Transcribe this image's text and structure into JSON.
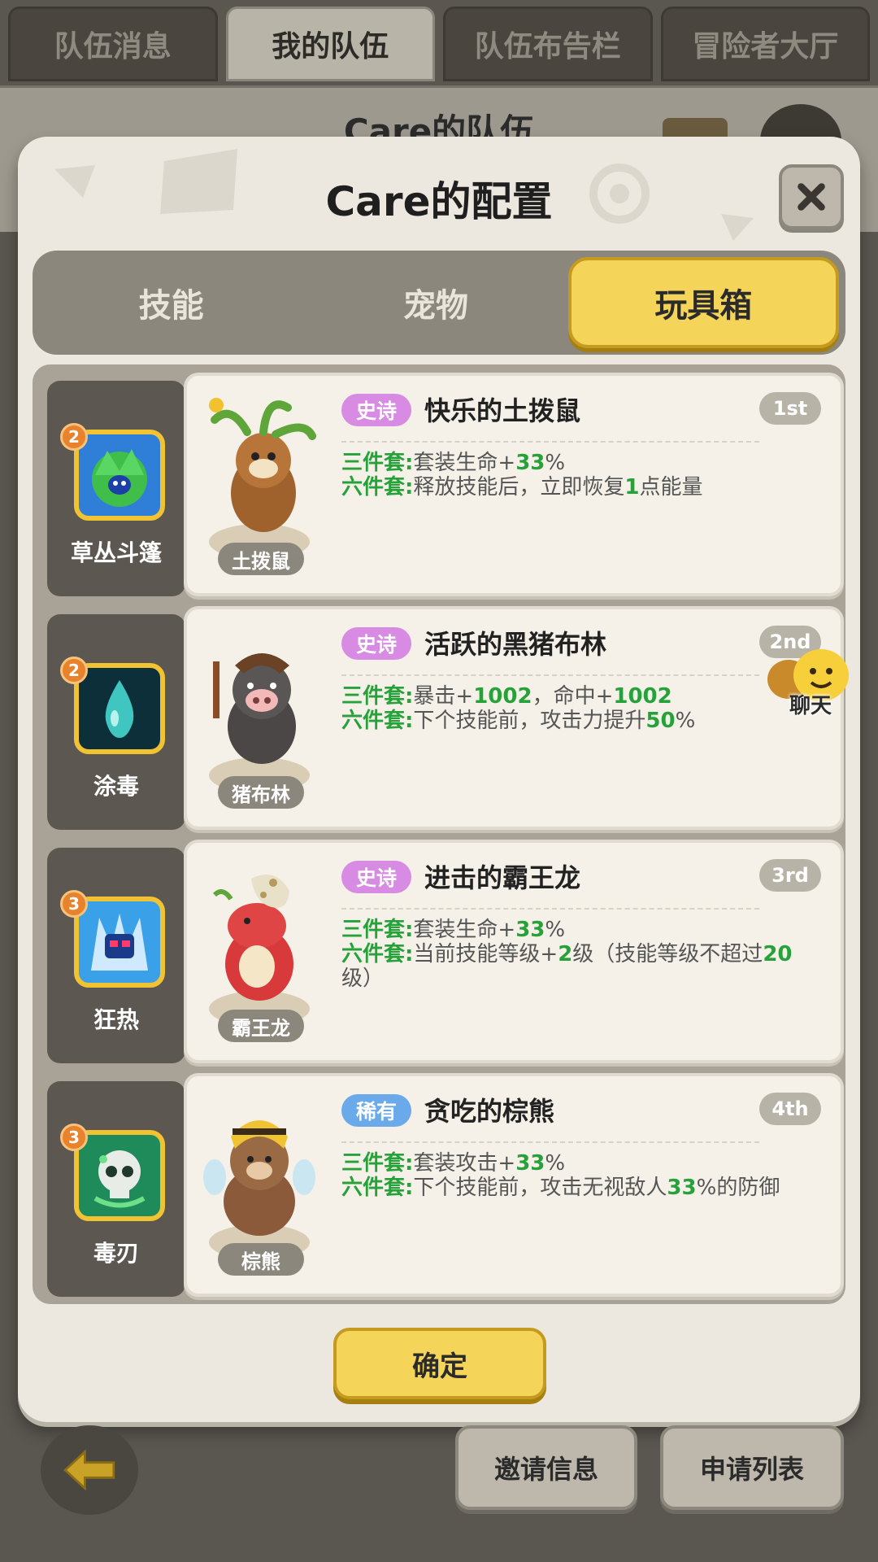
{
  "top_tabs": [
    {
      "label": "队伍消息",
      "active": false
    },
    {
      "label": "我的队伍",
      "active": true
    },
    {
      "label": "队伍布告栏",
      "active": false
    },
    {
      "label": "冒险者大厅",
      "active": false
    }
  ],
  "behind_title": "Care的队伍",
  "modal": {
    "title": "Care的配置",
    "close_icon": "close-x-icon",
    "sub_tabs": [
      {
        "label": "技能",
        "active": false
      },
      {
        "label": "宠物",
        "active": false
      },
      {
        "label": "玩具箱",
        "active": true
      }
    ],
    "rows": [
      {
        "skill": {
          "name": "草丛斗篷",
          "level": "2",
          "icon": "leaf-cloak-icon"
        },
        "pet_name": "土拨鼠",
        "rarity": "史诗",
        "title": "快乐的土拨鼠",
        "rank": "1st",
        "effects": [
          {
            "key": "三件套:",
            "parts": [
              "套装生命+",
              "33",
              "%"
            ]
          },
          {
            "key": "六件套:",
            "parts": [
              "释放技能后，立即恢复",
              "1",
              "点能量"
            ]
          }
        ]
      },
      {
        "skill": {
          "name": "涂毒",
          "level": "2",
          "icon": "poison-drop-icon"
        },
        "pet_name": "猪布林",
        "rarity": "史诗",
        "title": "活跃的黑猪布林",
        "rank": "2nd",
        "effects": [
          {
            "key": "三件套:",
            "parts": [
              "暴击+",
              "1002",
              "，命中+",
              "1002"
            ]
          },
          {
            "key": "六件套:",
            "parts": [
              "下个技能前，攻击力提升",
              "50",
              "%"
            ]
          }
        ]
      },
      {
        "skill": {
          "name": "狂热",
          "level": "3",
          "icon": "frenzy-icon"
        },
        "pet_name": "霸王龙",
        "rarity": "史诗",
        "title": "进击的霸王龙",
        "rank": "3rd",
        "effects": [
          {
            "key": "三件套:",
            "parts": [
              "套装生命+",
              "33",
              "%"
            ]
          },
          {
            "key": "六件套:",
            "parts": [
              "当前技能等级+",
              "2",
              "级（技能等级不超过",
              "20",
              "级）"
            ]
          }
        ]
      },
      {
        "skill": {
          "name": "毒刃",
          "level": "3",
          "icon": "poison-skull-icon"
        },
        "pet_name": "棕熊",
        "rarity": "稀有",
        "title": "贪吃的棕熊",
        "rank": "4th",
        "effects": [
          {
            "key": "三件套:",
            "parts": [
              "套装攻击+",
              "33",
              "%"
            ]
          },
          {
            "key": "六件套:",
            "parts": [
              "下个技能前，攻击无视敌人",
              "33",
              "%的防御"
            ]
          }
        ]
      }
    ],
    "confirm_label": "确定"
  },
  "chat_label": "聊天",
  "bottom": {
    "back_icon": "back-arrow-icon",
    "invite_label": "邀请信息",
    "apply_label": "申请列表"
  },
  "colors": {
    "accent_yellow": "#f5d45a",
    "epic": "#d88be3",
    "rare": "#6aa9ea",
    "green_text": "#27a23b"
  }
}
